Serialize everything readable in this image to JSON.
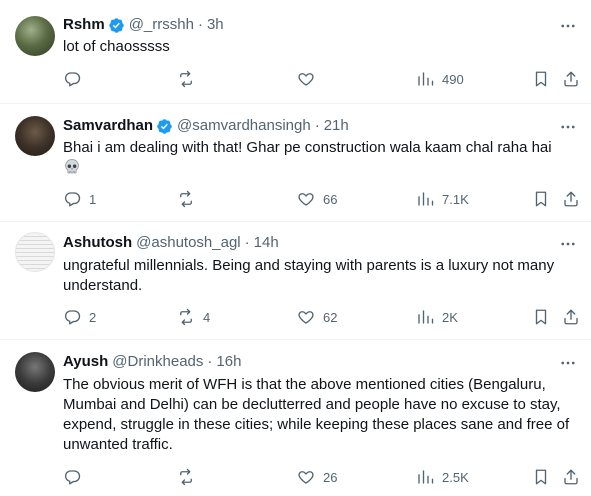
{
  "colors": {
    "verified_blue": "#1d9bf0",
    "text": "#0f1419",
    "muted": "#536471",
    "divider": "#eff3f4"
  },
  "tweets": [
    {
      "name": "Rshm",
      "verified": true,
      "handle": "@_rrsshh",
      "time": "3h",
      "text": "lot of chaosssss",
      "replies": "",
      "retweets": "",
      "likes": "",
      "views": "490"
    },
    {
      "name": "Samvardhan",
      "verified": true,
      "handle": "@samvardhansingh",
      "time": "21h",
      "text": "Bhai i am dealing with that! Ghar pe construction wala kaam chal raha hai",
      "emoji": "skull-emoji",
      "replies": "1",
      "retweets": "",
      "likes": "66",
      "views": "7.1K"
    },
    {
      "name": "Ashutosh",
      "verified": false,
      "handle": "@ashutosh_agl",
      "time": "14h",
      "text": "ungrateful millennials. Being and staying with parents is a luxury not many understand.",
      "replies": "2",
      "retweets": "4",
      "likes": "62",
      "views": "2K"
    },
    {
      "name": "Ayush",
      "verified": false,
      "handle": "@Drinkheads",
      "time": "16h",
      "text": "The obvious merit of WFH is that the above mentioned cities (Bengaluru, Mumbai and Delhi) can be declutterred and people have no excuse to stay, expend, struggle in these cities; while keeping these places sane and free of unwanted traffic.",
      "replies": "",
      "retweets": "",
      "likes": "26",
      "views": "2.5K"
    }
  ]
}
